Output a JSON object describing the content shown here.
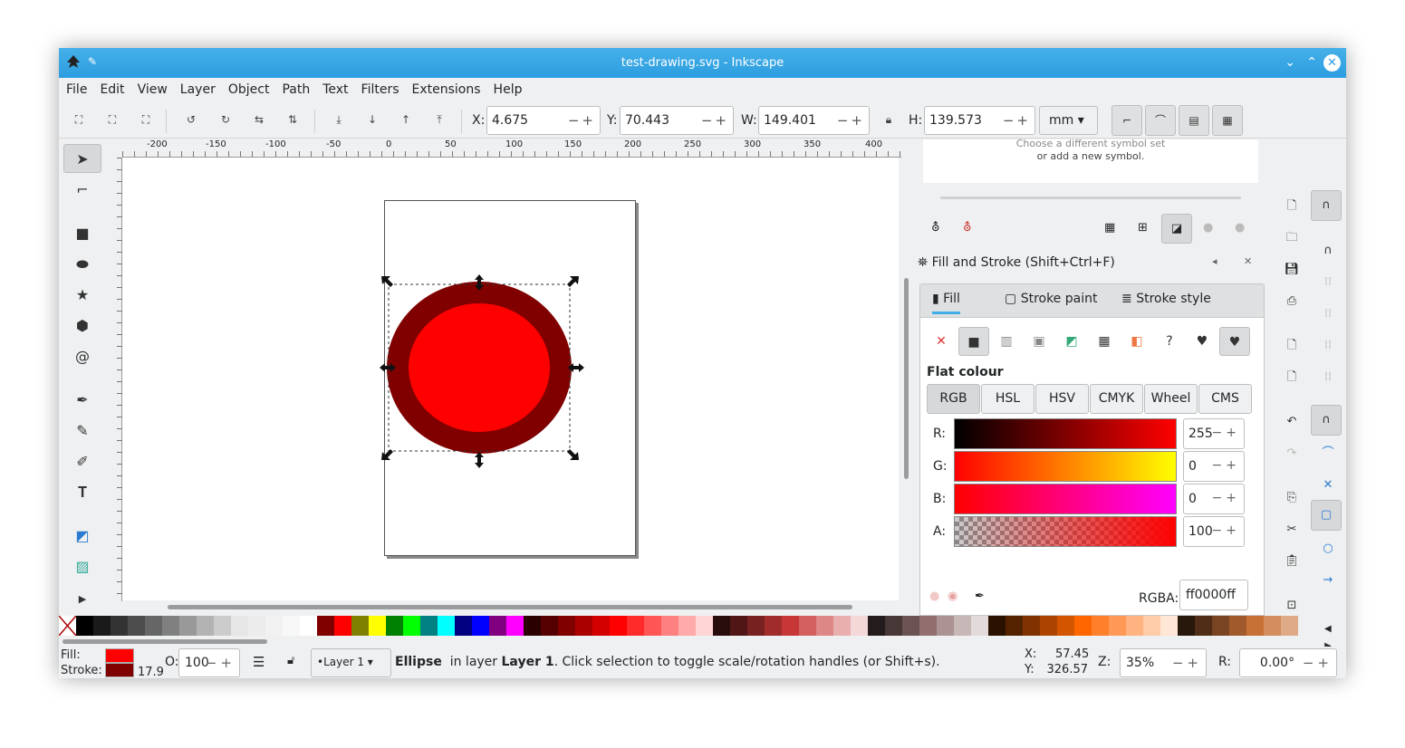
{
  "window": {
    "title": "test-drawing.svg - Inkscape"
  },
  "menu": [
    "File",
    "Edit",
    "View",
    "Layer",
    "Object",
    "Path",
    "Text",
    "Filters",
    "Extensions",
    "Help"
  ],
  "toolbar": {
    "x_label": "X:",
    "x_value": "4.675",
    "y_label": "Y:",
    "y_value": "70.443",
    "w_label": "W:",
    "w_value": "149.401",
    "h_label": "H:",
    "h_value": "139.573",
    "unit": "mm"
  },
  "ruler": {
    "ticks": [
      "-200",
      "-150",
      "-100",
      "-50",
      "0",
      "50",
      "100",
      "150",
      "200",
      "250",
      "300",
      "350",
      "400"
    ]
  },
  "symbols": {
    "hint_line1": "Choose a different symbol set",
    "hint_line2": "or add a new symbol."
  },
  "fill_stroke": {
    "header": "Fill and Stroke (Shift+Ctrl+F)",
    "tabs": [
      "Fill",
      "Stroke paint",
      "Stroke style"
    ],
    "flat_label": "Flat colour",
    "modes": [
      "RGB",
      "HSL",
      "HSV",
      "CMYK",
      "Wheel",
      "CMS"
    ],
    "channels": [
      {
        "label": "R:",
        "value": "255"
      },
      {
        "label": "G:",
        "value": "0"
      },
      {
        "label": "B:",
        "value": "0"
      },
      {
        "label": "A:",
        "value": "100"
      }
    ],
    "rgba_label": "RGBA:",
    "rgba_value": "ff0000ff"
  },
  "colors": {
    "fill": "#ff0000",
    "stroke": "#800000",
    "accent": "#3daee9"
  },
  "status": {
    "fill_label": "Fill:",
    "stroke_label": "Stroke:",
    "stroke_width": "17.9",
    "opacity_label": "O:",
    "opacity_value": "100",
    "layer": "•Layer 1",
    "message_bold1": "Ellipse",
    "message_mid": "in layer",
    "message_bold2": "Layer 1",
    "message_rest": ". Click selection to toggle scale/rotation handles (or Shift+s).",
    "x_label": "X:",
    "x_value": "57.45",
    "y_label": "Y:",
    "y_value": "326.57",
    "z_label": "Z:",
    "zoom": "35%",
    "r_label": "R:",
    "rotation": "0.00°"
  },
  "palette": [
    "#000000",
    "#1a1a1a",
    "#333333",
    "#4d4d4d",
    "#666666",
    "#808080",
    "#999999",
    "#b3b3b3",
    "#cccccc",
    "#e6e6e6",
    "#ececec",
    "#f2f2f2",
    "#f8f8f8",
    "#ffffff",
    "#800000",
    "#ff0000",
    "#808000",
    "#ffff00",
    "#008000",
    "#00ff00",
    "#008080",
    "#00ffff",
    "#000080",
    "#0000ff",
    "#800080",
    "#ff00ff",
    "#2b0000",
    "#550000",
    "#800000",
    "#aa0000",
    "#d40000",
    "#ff0000",
    "#ff2a2a",
    "#ff5555",
    "#ff8080",
    "#ffaaaa",
    "#ffd5d5",
    "#280b0b",
    "#501616",
    "#782121",
    "#a02c2c",
    "#c83737",
    "#d35f5f",
    "#de8787",
    "#e9afaf",
    "#f4d7d7",
    "#241c1c",
    "#483737",
    "#6c5353",
    "#916f6f",
    "#ac9393",
    "#c8b7b7",
    "#e3dbdb",
    "#2b1100",
    "#552200",
    "#803300",
    "#aa4400",
    "#d45500",
    "#ff6600",
    "#ff7f2a",
    "#ff9955",
    "#ffb380",
    "#ffccaa",
    "#ffe6d5",
    "#28170b",
    "#502d16",
    "#784421",
    "#a05a2c",
    "#c87137",
    "#d38d5f",
    "#deaa87"
  ]
}
